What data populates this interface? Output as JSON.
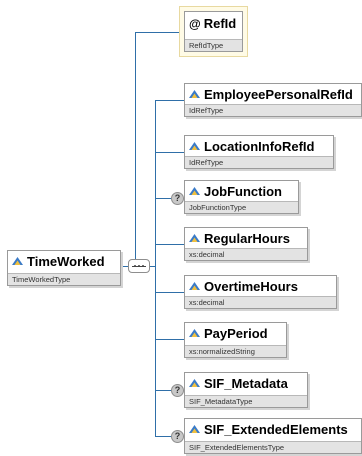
{
  "diagram": {
    "root": {
      "name": "TimeWorked",
      "type": "TimeWorkedType"
    },
    "attribute": {
      "symbol": "@",
      "name": "RefId",
      "type": "RefIdType"
    },
    "children": [
      {
        "name": "EmployeePersonalRefId",
        "type": "IdRefType",
        "optional": false
      },
      {
        "name": "LocationInfoRefId",
        "type": "IdRefType",
        "optional": false
      },
      {
        "name": "JobFunction",
        "type": "JobFunctionType",
        "optional": true
      },
      {
        "name": "RegularHours",
        "type": "xs:decimal",
        "optional": false
      },
      {
        "name": "OvertimeHours",
        "type": "xs:decimal",
        "optional": false
      },
      {
        "name": "PayPeriod",
        "type": "xs:normalizedString",
        "optional": false
      },
      {
        "name": "SIF_Metadata",
        "type": "SIF_MetadataType",
        "optional": true
      },
      {
        "name": "SIF_ExtendedElements",
        "type": "SIF_ExtendedElementsType",
        "optional": true
      }
    ],
    "optional_marker": "?",
    "colors": {
      "connector": "#2f6fa8",
      "type_bar": "#e3e3e3",
      "attribute_bg": "#fffbe6"
    },
    "icons": {
      "element": "element-icon",
      "attribute": "attribute-at-icon",
      "compositor": "sequence-compositor-icon"
    }
  }
}
